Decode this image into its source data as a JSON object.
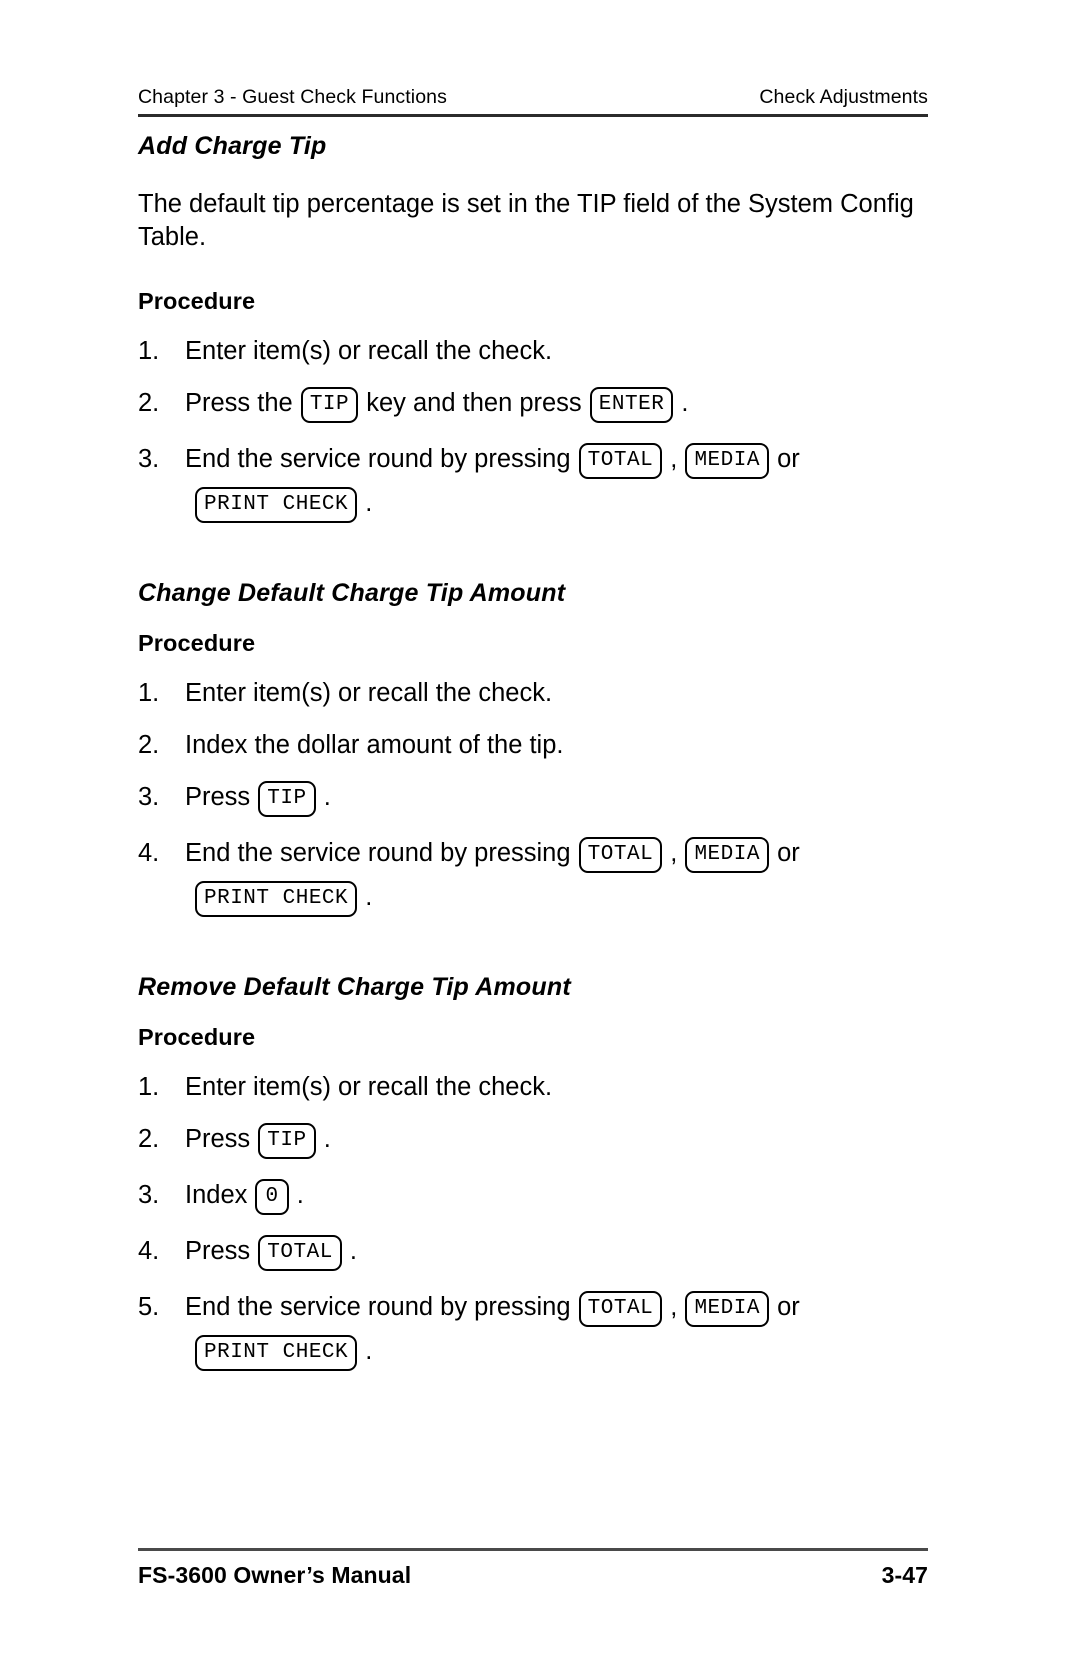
{
  "header": {
    "left": "Chapter 3 - Guest Check Functions",
    "right": "Check Adjustments"
  },
  "footer": {
    "left": "FS-3600 Owner’s Manual",
    "right": "3-47"
  },
  "sections": [
    {
      "title": "Add Charge Tip",
      "intro": "The default tip percentage is set in the TIP field of the System Config Table.",
      "procedure_label": "Procedure",
      "steps": [
        {
          "num": "1.",
          "line1": {
            "parts": [
              {
                "type": "text",
                "value": "Enter item(s) or recall the check."
              }
            ]
          }
        },
        {
          "num": "2.",
          "line1": {
            "parts": [
              {
                "type": "text",
                "value": "Press the"
              },
              {
                "type": "key",
                "value": "TIP"
              },
              {
                "type": "text",
                "value": "key and then press"
              },
              {
                "type": "key",
                "value": "ENTER"
              },
              {
                "type": "text",
                "value": "."
              }
            ]
          }
        },
        {
          "num": "3.",
          "line1": {
            "parts": [
              {
                "type": "text",
                "value": "End the service round by pressing"
              },
              {
                "type": "key",
                "value": "TOTAL"
              },
              {
                "type": "text",
                "value": ","
              },
              {
                "type": "key",
                "value": "MEDIA"
              },
              {
                "type": "text",
                "value": "or"
              }
            ]
          },
          "line2": {
            "parts": [
              {
                "type": "key",
                "value": "PRINT CHECK"
              },
              {
                "type": "text",
                "value": "."
              }
            ]
          }
        }
      ]
    },
    {
      "title": "Change Default Charge Tip Amount",
      "intro": "",
      "procedure_label": "Procedure",
      "steps": [
        {
          "num": "1.",
          "line1": {
            "parts": [
              {
                "type": "text",
                "value": "Enter item(s) or recall the check."
              }
            ]
          }
        },
        {
          "num": "2.",
          "line1": {
            "parts": [
              {
                "type": "text",
                "value": "Index the dollar amount of the tip."
              }
            ]
          }
        },
        {
          "num": "3.",
          "line1": {
            "parts": [
              {
                "type": "text",
                "value": "Press"
              },
              {
                "type": "key",
                "value": "TIP"
              },
              {
                "type": "text",
                "value": "."
              }
            ]
          }
        },
        {
          "num": "4.",
          "line1": {
            "parts": [
              {
                "type": "text",
                "value": "End the service round by pressing"
              },
              {
                "type": "key",
                "value": "TOTAL"
              },
              {
                "type": "text",
                "value": ","
              },
              {
                "type": "key",
                "value": "MEDIA"
              },
              {
                "type": "text",
                "value": "or"
              }
            ]
          },
          "line2": {
            "parts": [
              {
                "type": "key",
                "value": "PRINT CHECK"
              },
              {
                "type": "text",
                "value": "."
              }
            ]
          }
        }
      ]
    },
    {
      "title": "Remove Default Charge Tip Amount",
      "intro": "",
      "procedure_label": "Procedure",
      "steps": [
        {
          "num": "1.",
          "line1": {
            "parts": [
              {
                "type": "text",
                "value": "Enter item(s) or recall the check."
              }
            ]
          }
        },
        {
          "num": "2.",
          "line1": {
            "parts": [
              {
                "type": "text",
                "value": "Press"
              },
              {
                "type": "key",
                "value": "TIP"
              },
              {
                "type": "text",
                "value": "."
              }
            ]
          }
        },
        {
          "num": "3.",
          "line1": {
            "parts": [
              {
                "type": "text",
                "value": "Index"
              },
              {
                "type": "key",
                "value": "0"
              },
              {
                "type": "text",
                "value": "."
              }
            ]
          }
        },
        {
          "num": "4.",
          "line1": {
            "parts": [
              {
                "type": "text",
                "value": "Press"
              },
              {
                "type": "key",
                "value": "TOTAL"
              },
              {
                "type": "text",
                "value": "."
              }
            ]
          }
        },
        {
          "num": "5.",
          "line1": {
            "parts": [
              {
                "type": "text",
                "value": "End the service round by pressing"
              },
              {
                "type": "key",
                "value": "TOTAL"
              },
              {
                "type": "text",
                "value": ","
              },
              {
                "type": "key",
                "value": "MEDIA"
              },
              {
                "type": "text",
                "value": "or"
              }
            ]
          },
          "line2": {
            "parts": [
              {
                "type": "key",
                "value": "PRINT CHECK"
              },
              {
                "type": "text",
                "value": "."
              }
            ]
          }
        }
      ]
    }
  ]
}
